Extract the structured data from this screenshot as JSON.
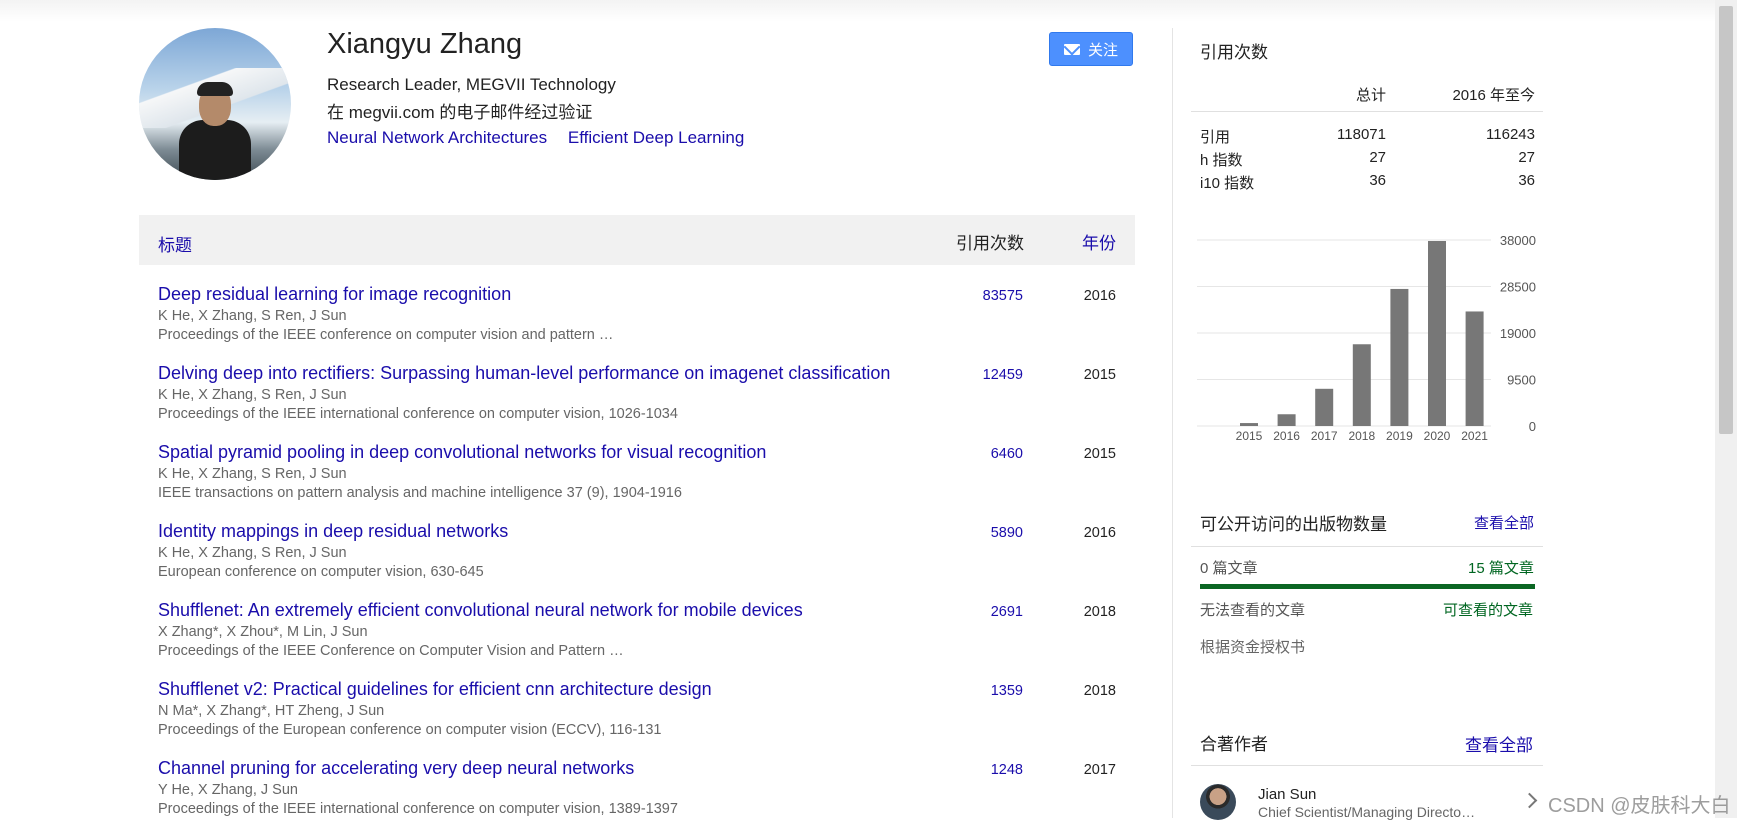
{
  "profile": {
    "name": "Xiangyu Zhang",
    "affiliation": "Research Leader, MEGVII Technology",
    "verified": "在 megvii.com 的电子邮件经过验证",
    "interests": [
      "Neural Network Architectures",
      "Efficient Deep Learning"
    ],
    "follow_label": "关注"
  },
  "table": {
    "header_title": "标题",
    "header_cited": "引用次数",
    "header_year": "年份",
    "rows": [
      {
        "title": "Deep residual learning for image recognition",
        "authors": "K He, X Zhang, S Ren, J Sun",
        "venue": "Proceedings of the IEEE conference on computer vision and pattern …",
        "cited": "83575",
        "year": "2016"
      },
      {
        "title": "Delving deep into rectifiers: Surpassing human-level performance on imagenet classification",
        "authors": "K He, X Zhang, S Ren, J Sun",
        "venue": "Proceedings of the IEEE international conference on computer vision, 1026-1034",
        "cited": "12459",
        "year": "2015"
      },
      {
        "title": "Spatial pyramid pooling in deep convolutional networks for visual recognition",
        "authors": "K He, X Zhang, S Ren, J Sun",
        "venue": "IEEE transactions on pattern analysis and machine intelligence 37 (9), 1904-1916",
        "cited": "6460",
        "year": "2015"
      },
      {
        "title": "Identity mappings in deep residual networks",
        "authors": "K He, X Zhang, S Ren, J Sun",
        "venue": "European conference on computer vision, 630-645",
        "cited": "5890",
        "year": "2016"
      },
      {
        "title": "Shufflenet: An extremely efficient convolutional neural network for mobile devices",
        "authors": "X Zhang*, X Zhou*, M Lin, J Sun",
        "venue": "Proceedings of the IEEE Conference on Computer Vision and Pattern …",
        "cited": "2691",
        "year": "2018"
      },
      {
        "title": "Shufflenet v2: Practical guidelines for efficient cnn architecture design",
        "authors": "N Ma*, X Zhang*, HT Zheng, J Sun",
        "venue": "Proceedings of the European conference on computer vision (ECCV), 116-131",
        "cited": "1359",
        "year": "2018"
      },
      {
        "title": "Channel pruning for accelerating very deep neural networks",
        "authors": "Y He, X Zhang, J Sun",
        "venue": "Proceedings of the IEEE international conference on computer vision, 1389-1397",
        "cited": "1248",
        "year": "2017"
      }
    ]
  },
  "citations": {
    "title": "引用次数",
    "col_all": "总计",
    "col_since": "2016 年至今",
    "rows": [
      {
        "label": "引用",
        "all": "118071",
        "since": "116243"
      },
      {
        "label": "h 指数",
        "all": "27",
        "since": "27"
      },
      {
        "label": "i10 指数",
        "all": "36",
        "since": "36"
      }
    ]
  },
  "chart_data": {
    "type": "bar",
    "categories": [
      "2015",
      "2016",
      "2017",
      "2018",
      "2019",
      "2020",
      "2021"
    ],
    "values": [
      600,
      2400,
      7600,
      16700,
      28000,
      37800,
      23400
    ],
    "yticks": [
      "38000",
      "28500",
      "19000",
      "9500",
      "0"
    ],
    "ylim": [
      0,
      38000
    ],
    "bar_color": "#777777"
  },
  "open_access": {
    "title": "可公开访问的出版物数量",
    "view_all": "查看全部",
    "not_available": "0 篇文章",
    "available": "15 篇文章",
    "not_available_label": "无法查看的文章",
    "available_label": "可查看的文章",
    "mandate": "根据资金授权书",
    "bar_color": "#0b6623"
  },
  "coauthors": {
    "title": "合著作者",
    "view_all": "查看全部",
    "items": [
      {
        "name": "Jian Sun",
        "affiliation": "Chief Scientist/Managing Directo…"
      }
    ]
  },
  "watermark": "CSDN @皮肤科大白"
}
